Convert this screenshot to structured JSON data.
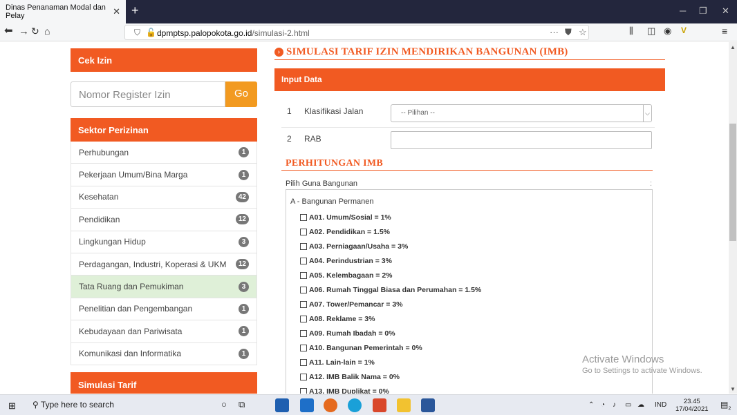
{
  "browser": {
    "tab_title": "Dinas Penanaman Modal dan Pelay",
    "tab_close": "✕",
    "new_tab": "+",
    "url_domain": "dpmptsp.palopokota.go.id",
    "url_path": "/simulasi-2.html",
    "more": "···"
  },
  "sidebar": {
    "cek_izin_title": "Cek Izin",
    "register_placeholder": "Nomor Register Izin",
    "go_label": "Go",
    "sektor_title": "Sektor Perizinan",
    "sectors": [
      {
        "label": "Perhubungan",
        "count": "1"
      },
      {
        "label": "Pekerjaan Umum/Bina Marga",
        "count": "1"
      },
      {
        "label": "Kesehatan",
        "count": "42"
      },
      {
        "label": "Pendidikan",
        "count": "12"
      },
      {
        "label": "Lingkungan Hidup",
        "count": "3"
      },
      {
        "label": "Perdagangan, Industri, Koperasi & UKM",
        "count": "12"
      },
      {
        "label": "Tata Ruang dan Pemukiman",
        "count": "3"
      },
      {
        "label": "Penelitian dan Pengembangan",
        "count": "1"
      },
      {
        "label": "Kebudayaan dan Pariwisata",
        "count": "1"
      },
      {
        "label": "Komunikasi dan Informatika",
        "count": "1"
      }
    ],
    "simulasi_title": "Simulasi Tarif"
  },
  "main": {
    "page_title": "SIMULASI TARIF IZIN MENDIRIKAN BANGUNAN (IMB)",
    "input_header": "Input Data",
    "rows": [
      {
        "no": "1",
        "label": "Klasifikasi Jalan",
        "select_value": "-- Pilihan --"
      },
      {
        "no": "2",
        "label": "RAB",
        "value": ""
      }
    ],
    "perhitungan_title": "PERHITUNGAN IMB",
    "guna_label": "Pilih Guna Bangunan",
    "guna_colon": ":",
    "category": "A - Bangunan Permanen",
    "options": [
      "A01. Umum/Sosial = 1%",
      "A02. Pendidikan = 1.5%",
      "A03. Perniagaan/Usaha = 3%",
      "A04. Perindustrian = 3%",
      "A05. Kelembagaan = 2%",
      "A06. Rumah Tinggal Biasa dan Perumahan = 1.5%",
      "A07. Tower/Pemancar = 3%",
      "A08. Reklame = 3%",
      "A09. Rumah Ibadah = 0%",
      "A10. Bangunan Pemerintah = 0%",
      "A11. Lain-lain = 1%",
      "A12. IMB Balik Nama = 0%",
      "A13. IMB Duplikat = 0%"
    ]
  },
  "watermark": {
    "line1": "Activate Windows",
    "line2": "Go to Settings to activate Windows."
  },
  "taskbar": {
    "search_placeholder": "Type here to search",
    "lang": "IND",
    "time": "23.45",
    "date": "17/04/2021",
    "notif_count": "2"
  },
  "colors": {
    "accent": "#f15a22",
    "go_button": "#f29a20",
    "active_row": "#dff0d8",
    "badge": "#777777",
    "title_bar": "#23263d"
  }
}
